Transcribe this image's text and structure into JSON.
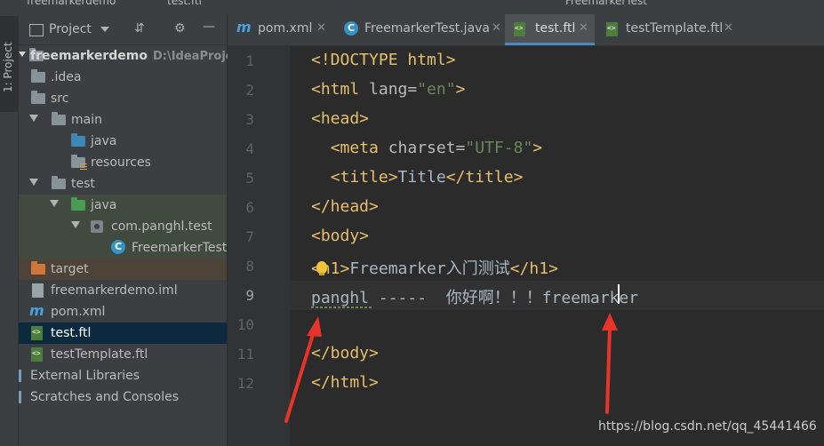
{
  "window": {
    "breadcrumb_project": "freemarkerdemo",
    "breadcrumb_file": "test.ftl",
    "run_config": "FreemarkerTest"
  },
  "left_strip": {
    "label": "1: Project"
  },
  "project_panel": {
    "title": "Project",
    "header_icons": [
      "collapse-icon",
      "gear-icon",
      "minimize-icon"
    ],
    "items": [
      {
        "label": "freemarkerdemo",
        "path": "D:\\IdeaProject",
        "kind": "module",
        "depth": 0
      },
      {
        "label": ".idea",
        "kind": "folder",
        "depth": 1
      },
      {
        "label": "src",
        "kind": "folder",
        "depth": 1
      },
      {
        "label": "main",
        "kind": "folder",
        "depth": 1
      },
      {
        "label": "java",
        "kind": "source-folder",
        "depth": 2
      },
      {
        "label": "resources",
        "kind": "resources-folder",
        "depth": 2
      },
      {
        "label": "test",
        "kind": "folder",
        "depth": 1
      },
      {
        "label": "java",
        "kind": "test-folder",
        "depth": 2
      },
      {
        "label": "com.panghl.test",
        "kind": "package",
        "depth": 3
      },
      {
        "label": "FreemarkerTest",
        "kind": "class",
        "depth": 4
      },
      {
        "label": "target",
        "kind": "excluded-folder",
        "depth": 1
      },
      {
        "label": "freemarkerdemo.iml",
        "kind": "iml-file",
        "depth": 1
      },
      {
        "label": "pom.xml",
        "kind": "maven-file",
        "depth": 1
      },
      {
        "label": "test.ftl",
        "kind": "ftl-file",
        "depth": 1,
        "selected": true
      },
      {
        "label": "testTemplate.ftl",
        "kind": "ftl-file",
        "depth": 1
      },
      {
        "label": "External Libraries",
        "kind": "libraries",
        "depth": 0
      },
      {
        "label": "Scratches and Consoles",
        "kind": "scratches",
        "depth": 0
      }
    ]
  },
  "tabs": [
    {
      "label": "pom.xml",
      "icon": "maven-icon"
    },
    {
      "label": "FreemarkerTest.java",
      "icon": "class-icon"
    },
    {
      "label": "test.ftl",
      "icon": "ftl-icon",
      "active": true
    },
    {
      "label": "testTemplate.ftl",
      "icon": "ftl-icon"
    }
  ],
  "editor": {
    "line_numbers": [
      "1",
      "2",
      "3",
      "4",
      "5",
      "6",
      "7",
      "8",
      "9",
      "10",
      "11",
      "12"
    ],
    "lines": [
      {
        "t1": "<!DOCTYPE html>"
      },
      {
        "t1": "<html",
        "t2": " lang=",
        "t3": "\"en\"",
        "t4": ">"
      },
      {
        "t1": "<head>"
      },
      {
        "t0": "  ",
        "t1": "<meta",
        "t2": " charset=",
        "t3": "\"UTF-8\"",
        "t4": ">"
      },
      {
        "t0": "  ",
        "t1": "<title>",
        "t2": "Title",
        "t3": "</title>"
      },
      {
        "t1": "</head>"
      },
      {
        "t1": "<body>"
      },
      {
        "t1": "<h1>",
        "t2": "Freemarker入门测试",
        "t3": "</h1>"
      },
      {
        "t1": "panghl -----  你好啊！！！freemarker"
      },
      {
        "t1": ""
      },
      {
        "t1": "</body>"
      },
      {
        "t1": "</html>"
      }
    ],
    "current_line": 9
  },
  "watermark": "https://blog.csdn.net/qq_45441466",
  "colors": {
    "accent": "#4a88c7",
    "annotation_arrow": "#e8332a",
    "selection": "#0d293e",
    "tag": "#e8bf6a",
    "string": "#6a8759"
  }
}
